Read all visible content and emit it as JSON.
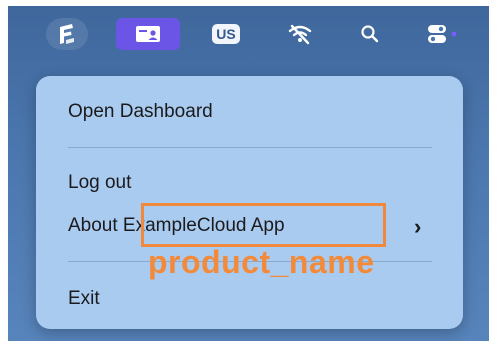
{
  "menubar": {
    "us_label": "US"
  },
  "menu": {
    "items": [
      {
        "label": "Open Dashboard"
      },
      {
        "label": "Log out"
      },
      {
        "label": "About ExampleCloud App"
      },
      {
        "label": "Exit"
      }
    ],
    "submenu_chevron": "›"
  },
  "annotation": {
    "label": "product_name",
    "color": "#f28a3a"
  },
  "colors": {
    "desktop": "#4a76ad",
    "menu_bg": "#aacbf0",
    "active_icon_bg": "#6b55e6",
    "highlight": "#f0883e"
  }
}
